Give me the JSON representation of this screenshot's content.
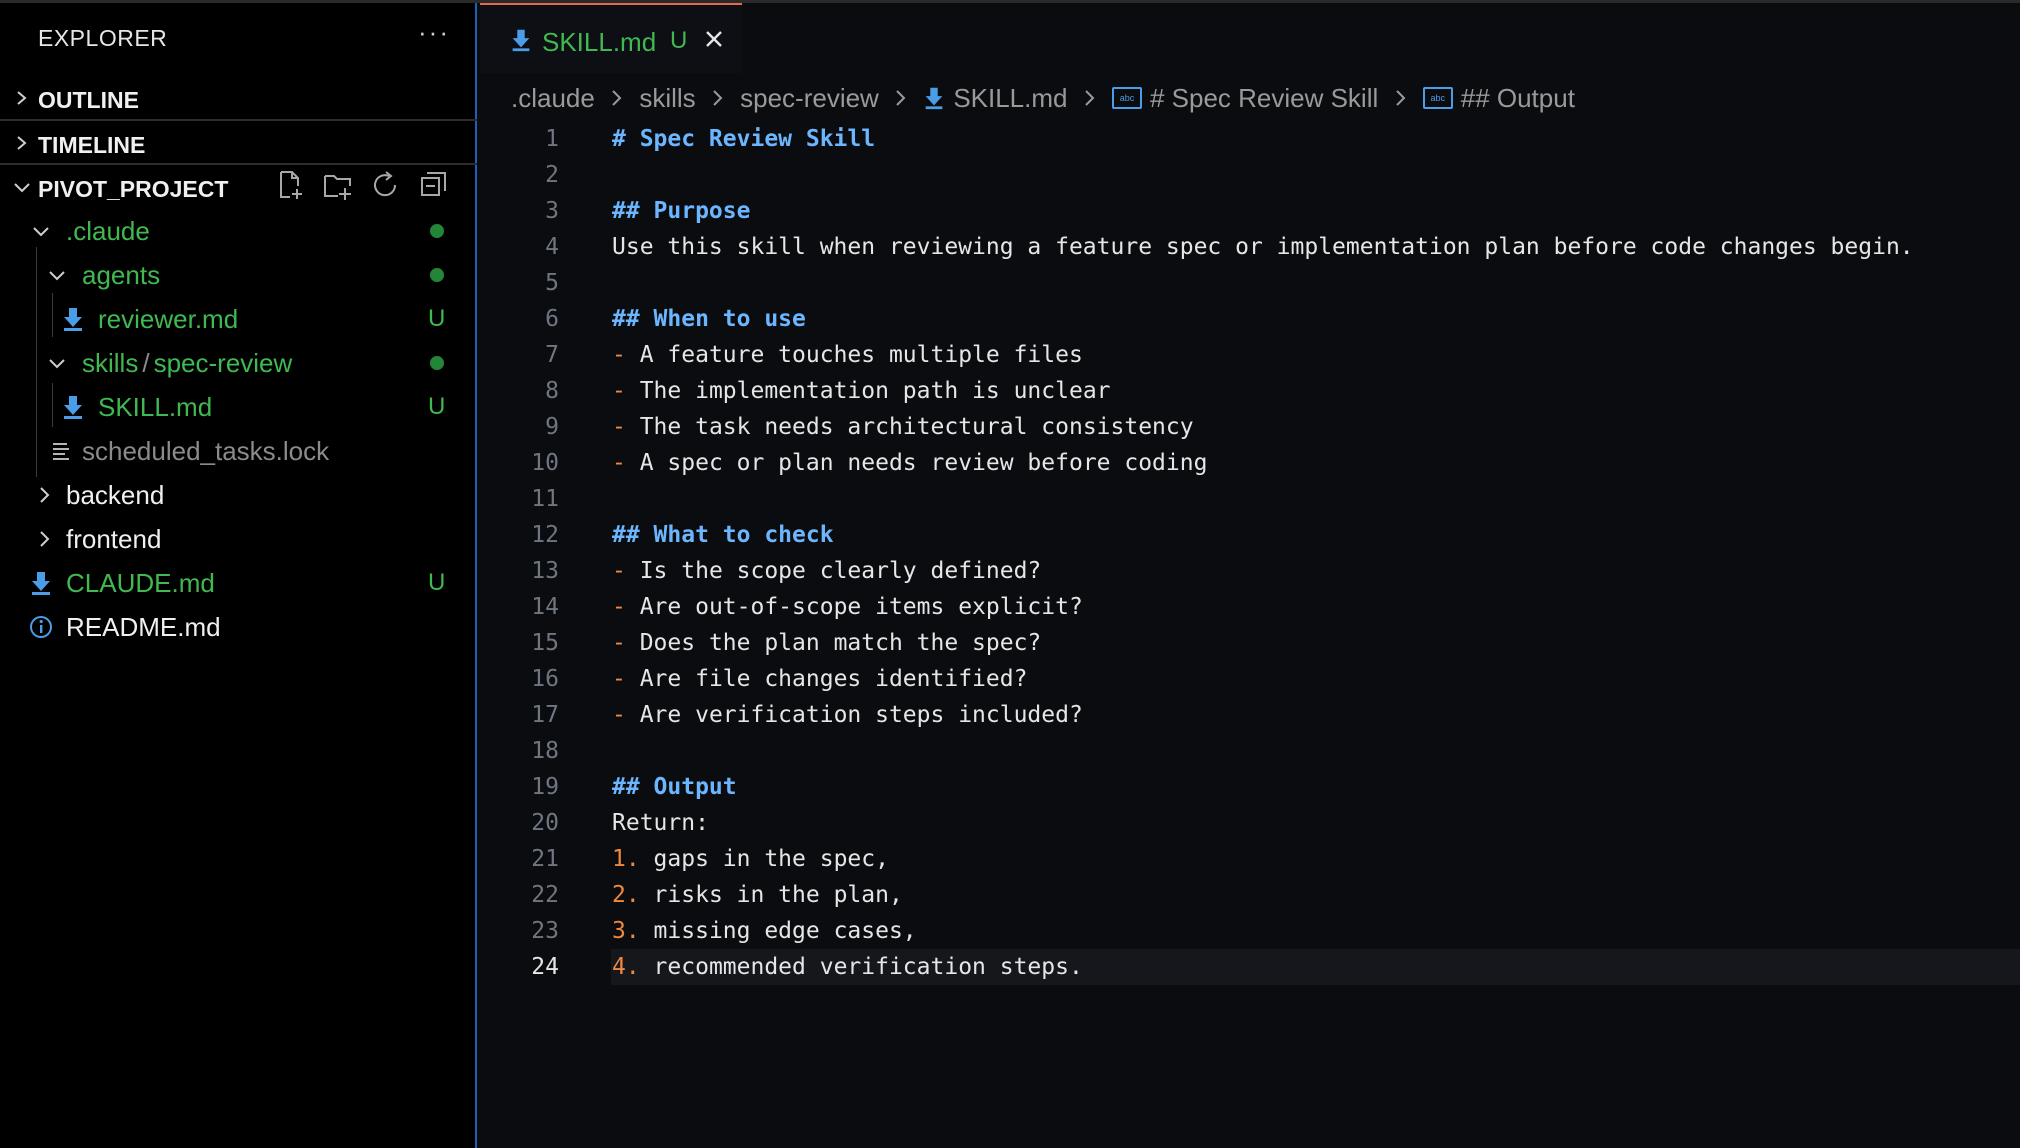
{
  "explorer": {
    "title": "EXPLORER",
    "more": "···",
    "sections": {
      "outline": "OUTLINE",
      "timeline": "TIMELINE",
      "project": "PIVOT_PROJECT"
    },
    "tree": {
      "claude": ".claude",
      "agents": "agents",
      "reviewer": "reviewer.md",
      "reviewer_badge": "U",
      "skills": "skills",
      "skills_sep": "/",
      "spec_review": "spec-review",
      "skill_md": "SKILL.md",
      "skill_badge": "U",
      "scheduled": "scheduled_tasks.lock",
      "backend": "backend",
      "frontend": "frontend",
      "claude_md": "CLAUDE.md",
      "claude_md_badge": "U",
      "readme": "README.md"
    }
  },
  "tab": {
    "name": "SKILL.md",
    "badge": "U"
  },
  "breadcrumb": {
    "items": [
      ".claude",
      "skills",
      "spec-review",
      "SKILL.md",
      "# Spec Review Skill",
      "## Output"
    ],
    "sym_icon": "abc"
  },
  "editor": {
    "active_line": 24,
    "lines": [
      {
        "n": "1",
        "text": "# Spec Review Skill"
      },
      {
        "n": "2",
        "text": ""
      },
      {
        "n": "3",
        "text": "## Purpose"
      },
      {
        "n": "4",
        "text": "Use this skill when reviewing a feature spec or implementation plan before code changes begin."
      },
      {
        "n": "5",
        "text": ""
      },
      {
        "n": "6",
        "text": "## When to use"
      },
      {
        "n": "7",
        "marker": "-",
        "text": " A feature touches multiple files"
      },
      {
        "n": "8",
        "marker": "-",
        "text": " The implementation path is unclear"
      },
      {
        "n": "9",
        "marker": "-",
        "text": " The task needs architectural consistency"
      },
      {
        "n": "10",
        "marker": "-",
        "text": " A spec or plan needs review before coding"
      },
      {
        "n": "11",
        "text": ""
      },
      {
        "n": "12",
        "text": "## What to check"
      },
      {
        "n": "13",
        "marker": "-",
        "text": " Is the scope clearly defined?"
      },
      {
        "n": "14",
        "marker": "-",
        "text": " Are out-of-scope items explicit?"
      },
      {
        "n": "15",
        "marker": "-",
        "text": " Does the plan match the spec?"
      },
      {
        "n": "16",
        "marker": "-",
        "text": " Are file changes identified?"
      },
      {
        "n": "17",
        "marker": "-",
        "text": " Are verification steps included?"
      },
      {
        "n": "18",
        "text": ""
      },
      {
        "n": "19",
        "text": "## Output"
      },
      {
        "n": "20",
        "text": "Return:"
      },
      {
        "n": "21",
        "marker": "1.",
        "text": " gaps in the spec,"
      },
      {
        "n": "22",
        "marker": "2.",
        "text": " risks in the plan,"
      },
      {
        "n": "23",
        "marker": "3.",
        "text": " missing edge cases,"
      },
      {
        "n": "24",
        "marker": "4.",
        "text": " recommended verification steps."
      }
    ]
  },
  "colors": {
    "accent_green": "#3fb950",
    "heading_blue": "#6cb6ff",
    "list_orange": "#f0883e",
    "tab_top": "#e06c4a",
    "focus_border": "#1f5fb8"
  }
}
